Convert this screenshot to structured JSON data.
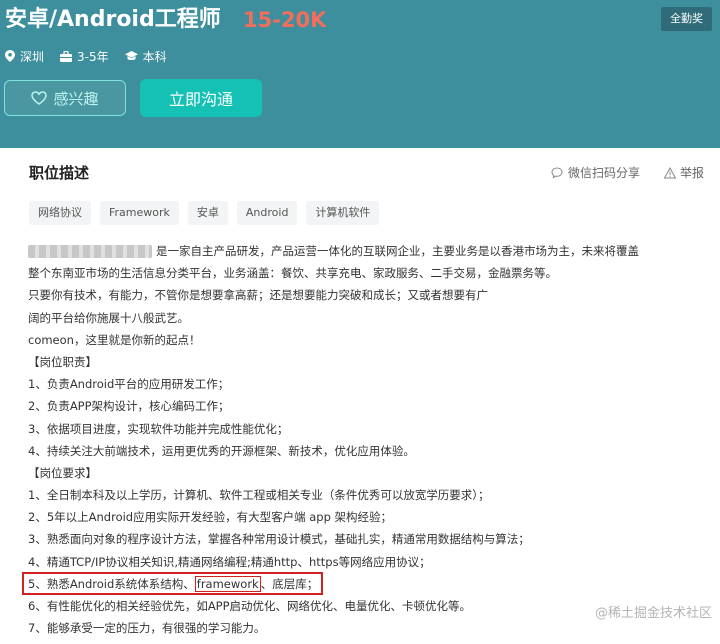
{
  "job": {
    "title": "安卓/Android工程师",
    "salary": "15-20K",
    "badge": "全勤奖",
    "meta": [
      {
        "icon": "location-pin-icon",
        "text": "深圳"
      },
      {
        "icon": "briefcase-icon",
        "text": "3-5年"
      },
      {
        "icon": "graduation-cap-icon",
        "text": "本科"
      }
    ]
  },
  "actions": {
    "interest_label": "感兴趣",
    "chat_label": "立即沟通"
  },
  "colors": {
    "hero_bg": "#3d8f9d",
    "salary": "#f26d5b",
    "chat_button": "#14c1b4",
    "highlight_red": "#d32020"
  },
  "section": {
    "title": "职位描述",
    "share_label": "微信扫码分享",
    "report_label": "举报"
  },
  "tags": [
    "网络协议",
    "Framework",
    "安卓",
    "Android",
    "计算机软件"
  ],
  "description": {
    "intro_first": "是一家自主产品研发，产品运营一体化的互联网企业，主要业务是以香港市场为主，未来将覆盖",
    "lines": [
      "整个东南亚市场的生活信息分类平台，业务涵盖：餐饮、共享充电、家政服务、二手交易，金融票务等。",
      "只要你有技术，有能力，不管你是想要拿高薪；还是想要能力突破和成长；又或者想要有广",
      "阔的平台给你施展十八般武艺。",
      "comeon，这里就是你新的起点！",
      "【岗位职责】",
      "1、负责Android平台的应用研发工作；",
      "2、负责APP架构设计，核心编码工作；",
      "3、依据项目进度，实现软件功能并完成性能优化；",
      "4、持续关注大前端技术，运用更优秀的开源框架、新技术，优化应用体验。",
      "【岗位要求】",
      "1、全日制本科及以上学历，计算机、软件工程或相关专业（条件优秀可以放宽学历要求）；",
      "2、5年以上Android应用实际开发经验，有大型客户端 app 架构经验；",
      "3、熟悉面向对象的程序设计方法，掌握各种常用设计模式，基础扎实，精通常用数据结构与算法；",
      "4、精通TCP/IP协议相关知识,精通网络编程;精通http、https等网络应用协议；"
    ],
    "req5_before": "5、熟悉Android系统体系结构、",
    "req5_highlight": "framework",
    "req5_after": "、底层库；",
    "lines_after": [
      "6、有性能优化的相关经验优先，如APP启动优化、网络优化、电量优化、卡顿优化等。",
      "7、能够承受一定的压力，有很强的学习能力。"
    ]
  },
  "watermark": "@稀土掘金技术社区"
}
